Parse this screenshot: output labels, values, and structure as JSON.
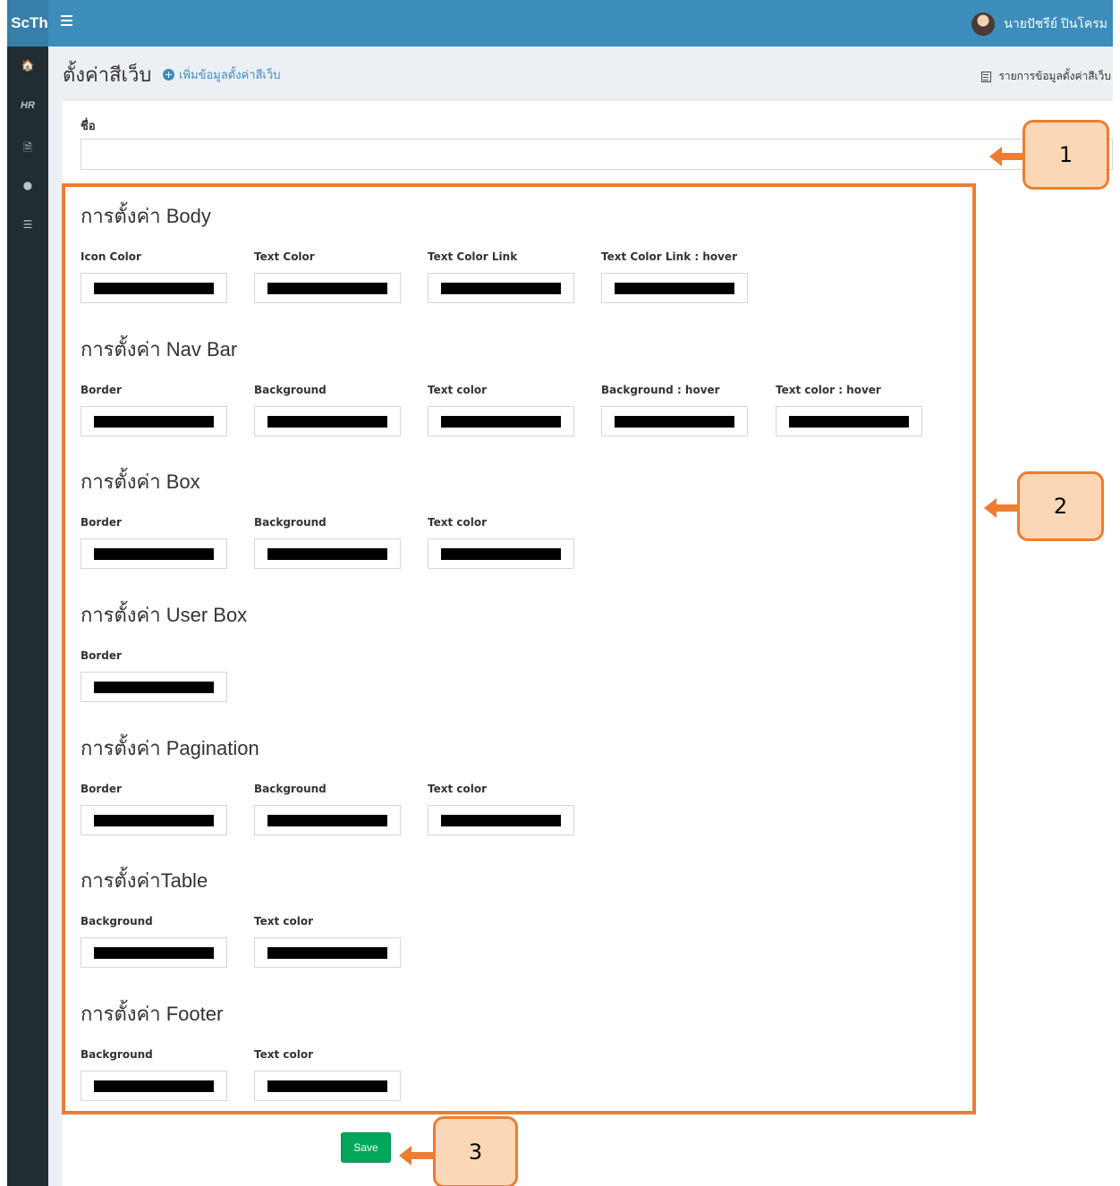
{
  "app": {
    "brand": "ScTh",
    "user_name": "นายปัชรีย์ ปินโครม"
  },
  "sidebar": {
    "items": [
      {
        "icon": "home-icon",
        "glyph": "🏠"
      },
      {
        "icon": "hr-icon",
        "label": "HR"
      },
      {
        "icon": "file-icon",
        "glyph": "🗎"
      },
      {
        "icon": "globe-icon",
        "glyph": "●"
      },
      {
        "icon": "server-icon",
        "glyph": "☰"
      }
    ]
  },
  "header": {
    "title": "ตั้งค่าสีเว็บ",
    "add_link": "เพิ่มข้อมูลตั้งค่าสีเว็บ",
    "list_link": "รายการข้อมูลตั้งค่าสีเว็บ"
  },
  "form": {
    "name_label": "ชื่อ",
    "name_value": "",
    "swatch_color": "#000000",
    "sections": [
      {
        "title": "การตั้งค่า Body",
        "fields": [
          "Icon Color",
          "Text Color",
          "Text Color Link",
          "Text Color Link : hover"
        ]
      },
      {
        "title": "การตั้งค่า Nav Bar",
        "fields": [
          "Border",
          "Background",
          "Text color",
          "Background : hover",
          "Text color : hover"
        ]
      },
      {
        "title": "การตั้งค่า Box",
        "fields": [
          "Border",
          "Background",
          "Text color"
        ]
      },
      {
        "title": "การตั้งค่า User Box",
        "fields": [
          "Border"
        ]
      },
      {
        "title": "การตั้งค่า Pagination",
        "fields": [
          "Border",
          "Background",
          "Text color"
        ]
      },
      {
        "title": "การตั้งค่าTable",
        "fields": [
          "Background",
          "Text color"
        ]
      },
      {
        "title": "การตั้งค่า Footer",
        "fields": [
          "Background",
          "Text color"
        ]
      }
    ],
    "save_label": "Save"
  },
  "annotations": {
    "callouts": [
      "1",
      "2",
      "3"
    ],
    "color": "#ed7d31",
    "fill": "#fbd7b6"
  }
}
